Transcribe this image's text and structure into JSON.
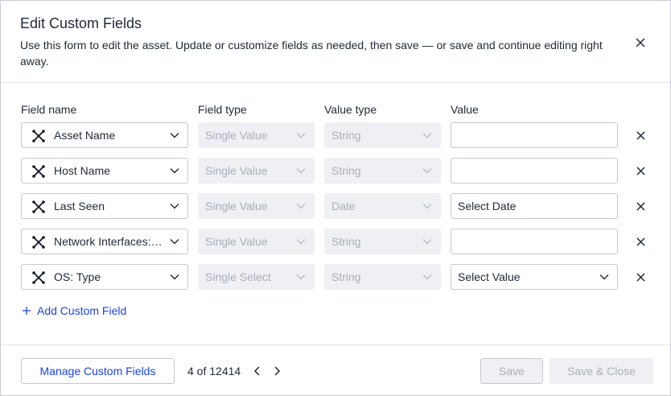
{
  "dialog": {
    "title": "Edit Custom Fields",
    "subtitle": "Use this form to edit the asset. Update or customize fields as needed, then save — or save and continue editing right away."
  },
  "columns": {
    "field_name": "Field name",
    "field_type": "Field type",
    "value_type": "Value type",
    "value": "Value"
  },
  "rows": [
    {
      "field_name": "Asset Name",
      "field_type": "Single Value",
      "value_type": "String",
      "value": ""
    },
    {
      "field_name": "Host Name",
      "field_type": "Single Value",
      "value_type": "String",
      "value": ""
    },
    {
      "field_name": "Last Seen",
      "field_type": "Single Value",
      "value_type": "Date",
      "value": "Select Date"
    },
    {
      "field_name": "Network Interfaces: ...",
      "field_type": "Single Value",
      "value_type": "String",
      "value": ""
    },
    {
      "field_name": "OS: Type",
      "field_type": "Single Select",
      "value_type": "String",
      "value": "Select Value"
    }
  ],
  "add_field_label": "Add Custom Field",
  "footer": {
    "manage_label": "Manage Custom Fields",
    "pager": "4 of 12414",
    "save_label": "Save",
    "save_close_label": "Save & Close"
  },
  "colors": {
    "accent": "#1a44e8",
    "disabled_bg": "#eef0f4",
    "disabled_text": "#a9aeb8",
    "border": "#c4c8cf"
  }
}
